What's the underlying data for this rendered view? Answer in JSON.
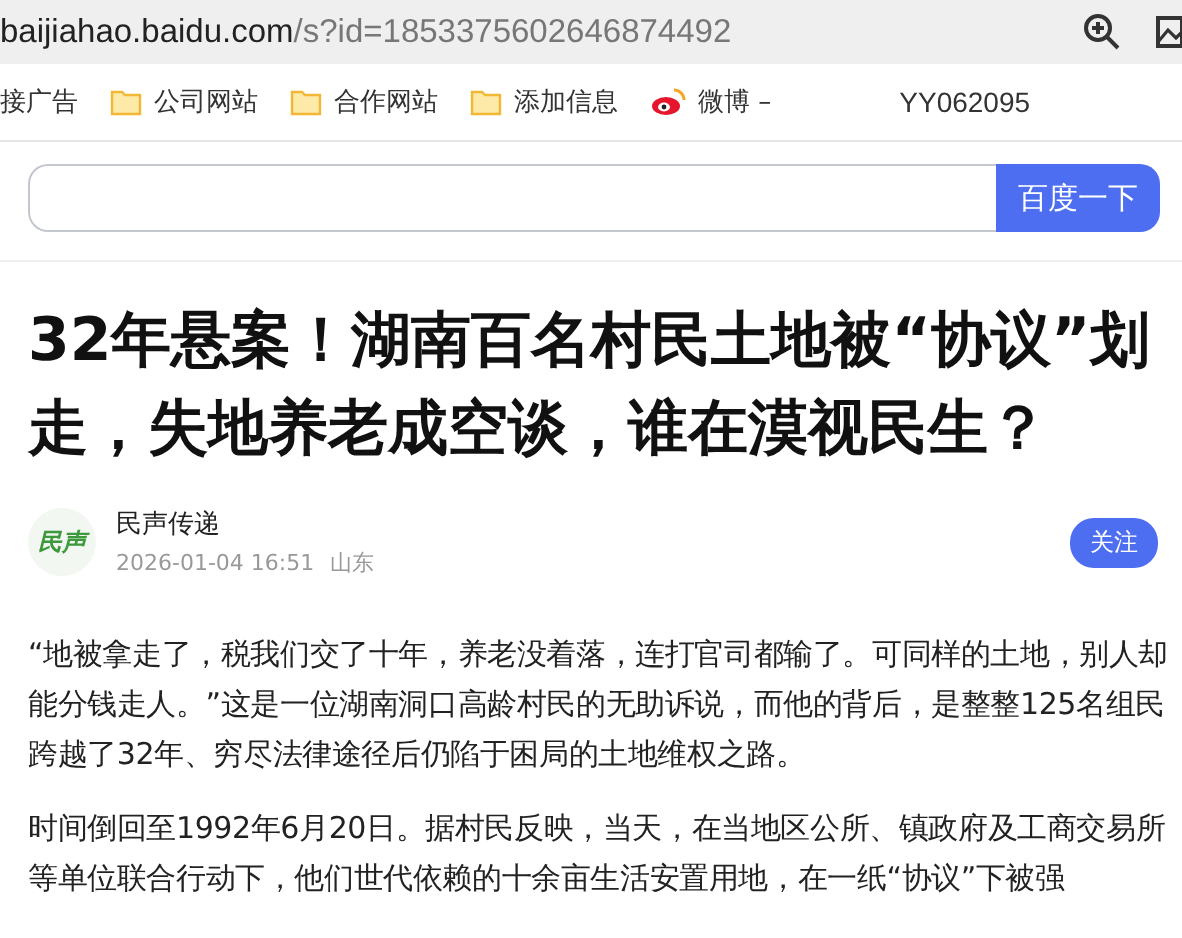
{
  "address_bar": {
    "host": "baijiahao.baidu.com",
    "path": "/s?id=1853375602646874492"
  },
  "bookmarks": [
    {
      "kind": "text",
      "label": "接广告"
    },
    {
      "kind": "folder",
      "label": "公司网站"
    },
    {
      "kind": "folder",
      "label": "合作网站"
    },
    {
      "kind": "folder",
      "label": "添加信息"
    },
    {
      "kind": "weibo",
      "label": "微博 –"
    },
    {
      "kind": "text",
      "label": "YY062095"
    }
  ],
  "search": {
    "button": "百度一下"
  },
  "article": {
    "title": "32年悬案！湖南百名村民土地被“协议”划走，失地养老成空谈，谁在漠视民生？",
    "author": {
      "logo_text": "民声",
      "name": "民声传递",
      "date": "2026-01-04 16:51",
      "location": "山东",
      "follow": "关注"
    },
    "paragraphs": [
      "“地被拿走了，税我们交了十年，养老没着落，连打官司都输了。可同样的土地，别人却能分钱走人。”这是一位湖南洞口高龄村民的无助诉说，而他的背后，是整整125名组民跨越了32年、穷尽法律途径后仍陷于困局的土地维权之路。",
      "时间倒回至1992年6月20日。据村民反映，当天，在当地区公所、镇政府及工商交易所等单位联合行动下，他们世代依赖的十余亩生活安置用地，在一纸“协议”下被强"
    ]
  }
}
